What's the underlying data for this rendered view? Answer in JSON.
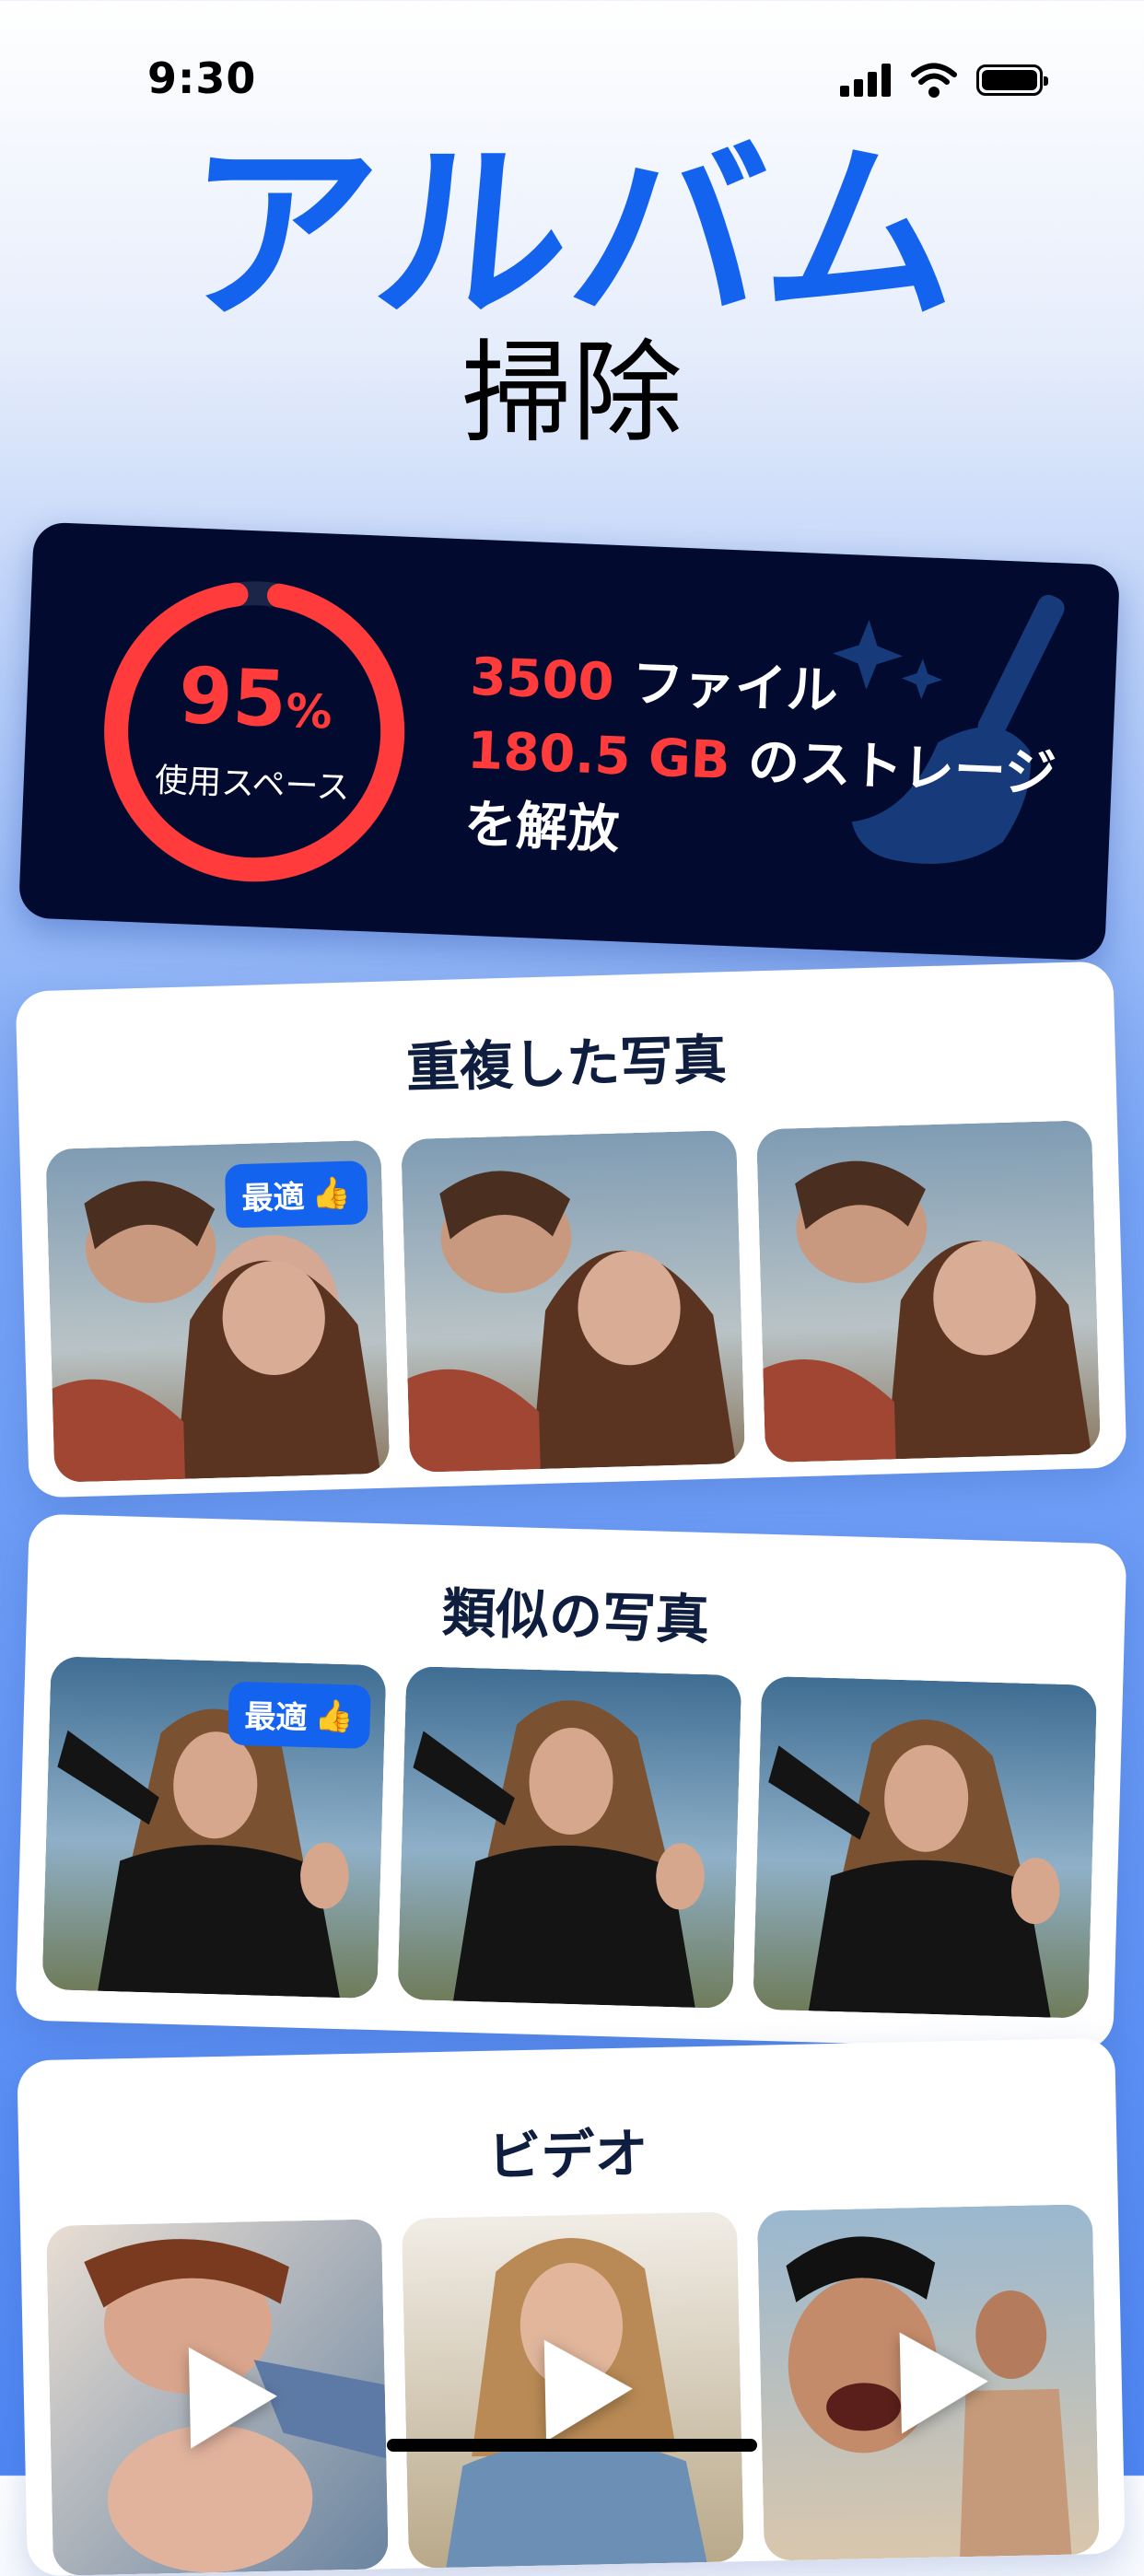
{
  "status_bar": {
    "time": "9:30"
  },
  "title": {
    "main": "アルバム",
    "sub": "掃除"
  },
  "storage": {
    "percent": "95",
    "percent_sign": "%",
    "used_label": "使用スペース",
    "used_fraction": 0.95,
    "files_count": "3500",
    "files_label": " ファイル",
    "size_value": "180.5 GB",
    "size_label": " のストレージ",
    "free_label": "を解放"
  },
  "sections": {
    "duplicates": {
      "title": "重複した写真",
      "badge_label": "最適"
    },
    "similar": {
      "title": "類似の写真",
      "badge_label": "最適"
    },
    "videos": {
      "title": "ビデオ"
    }
  },
  "colors": {
    "accent": "#1463ef",
    "danger": "#ff3b3b",
    "card_dark": "#020b2f"
  }
}
